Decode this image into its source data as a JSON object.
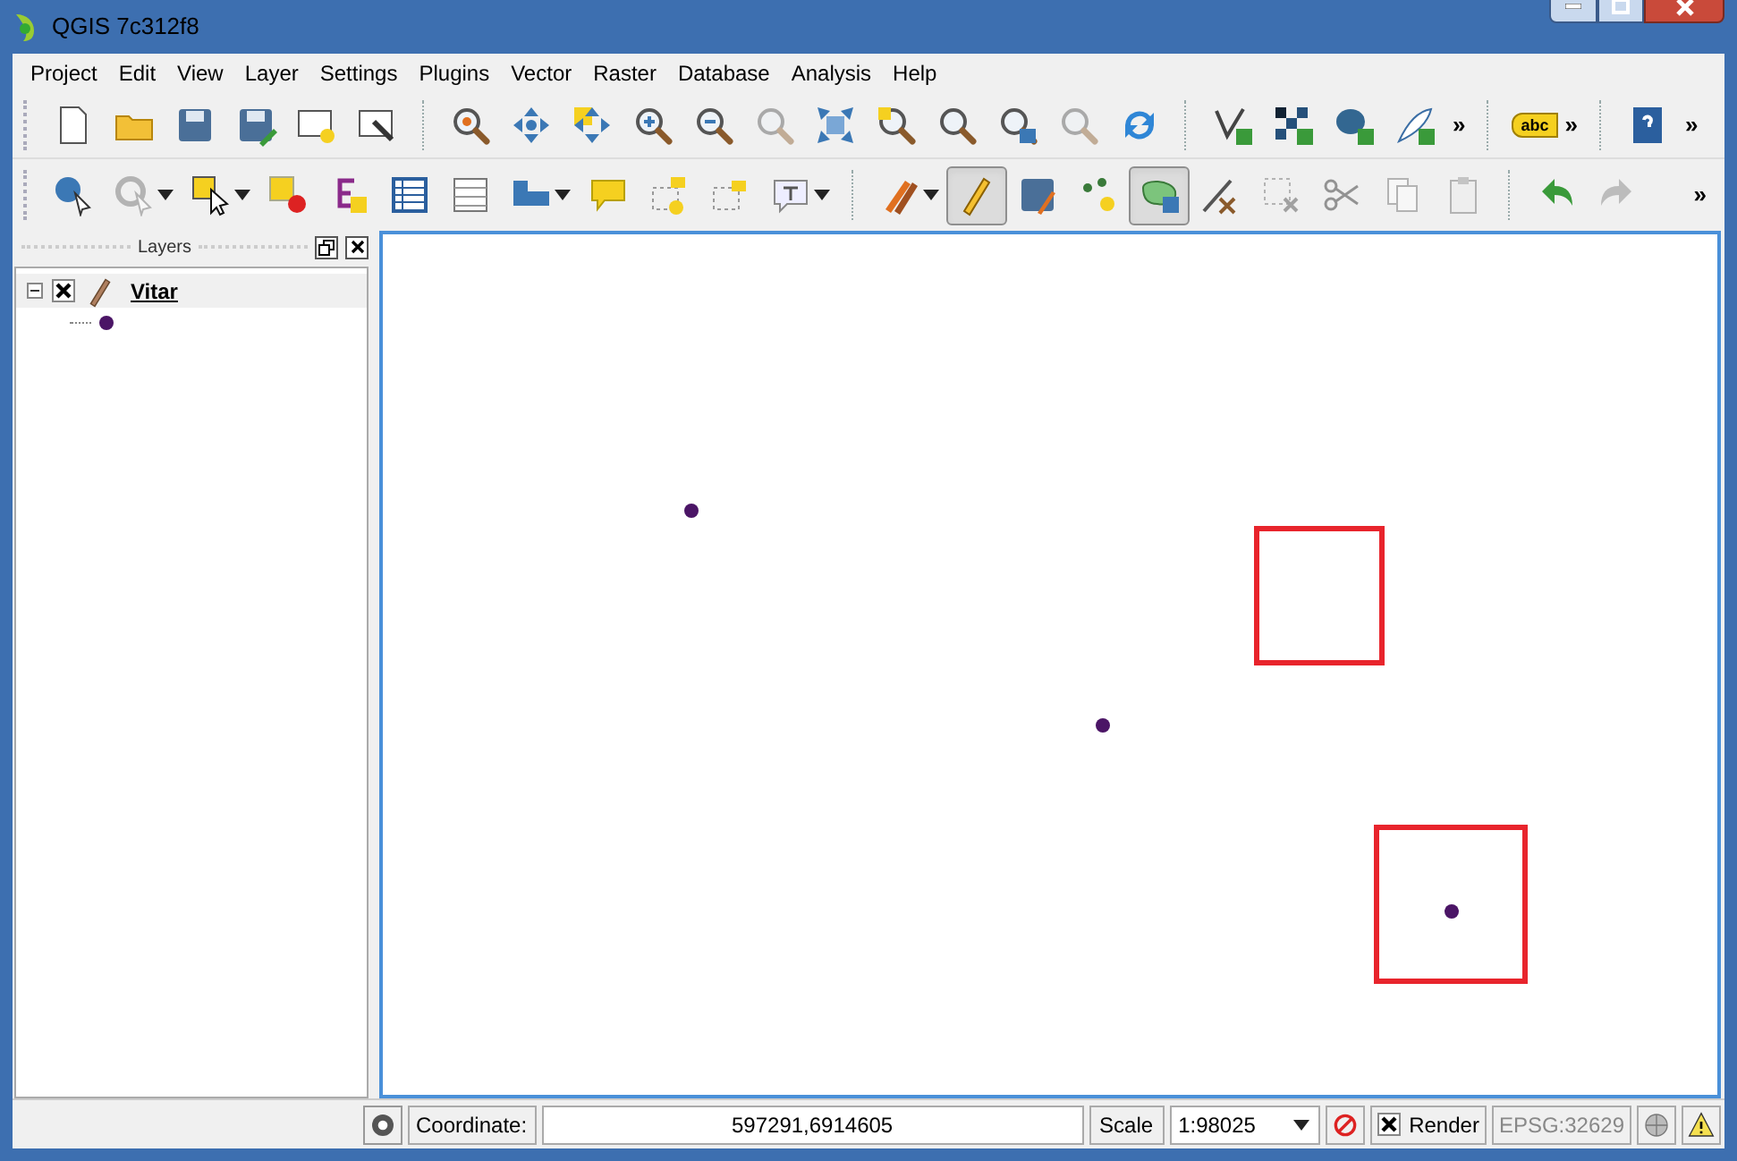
{
  "window": {
    "title": "QGIS 7c312f8"
  },
  "menu": [
    "Project",
    "Edit",
    "View",
    "Layer",
    "Settings",
    "Plugins",
    "Vector",
    "Raster",
    "Database",
    "Analysis",
    "Help"
  ],
  "toolbar_1": {
    "overflow": [
      "»",
      "»",
      "»"
    ],
    "label_tool_text": "abc"
  },
  "toolbar_2": {
    "overflow": "»",
    "toggle_editing_pressed": true,
    "node_tool_pressed": true
  },
  "layers_panel": {
    "title": "Layers",
    "layers": [
      {
        "name": "Vitar",
        "visible": true,
        "expanded": true
      }
    ]
  },
  "status_bar": {
    "coordinate_label": "Coordinate:",
    "coordinate": "597291,6914605",
    "scale_label": "Scale",
    "scale": "1:98025",
    "render_label": "Render",
    "render": true,
    "crs": "EPSG:32629"
  }
}
